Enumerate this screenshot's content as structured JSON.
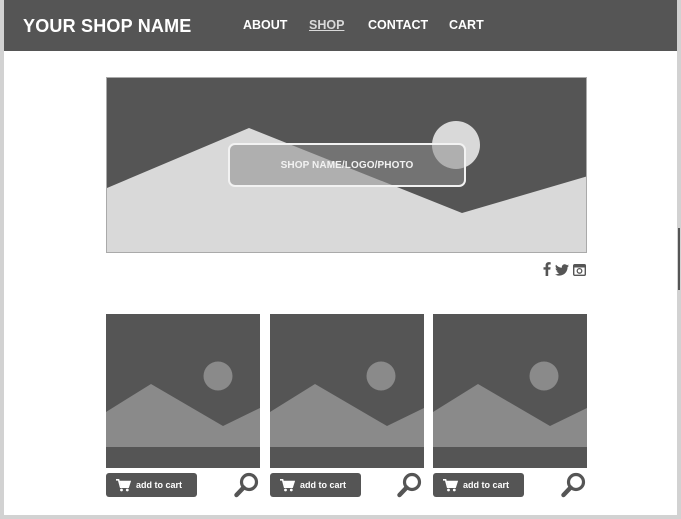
{
  "header": {
    "brand": "YOUR SHOP NAME",
    "nav": [
      {
        "label": "ABOUT",
        "active": false
      },
      {
        "label": "SHOP",
        "active": true
      },
      {
        "label": "CONTACT",
        "active": false
      },
      {
        "label": "CART",
        "active": false
      }
    ]
  },
  "hero": {
    "label": "SHOP NAME/LOGO/PHOTO"
  },
  "social": [
    "facebook-icon",
    "twitter-icon",
    "instagram-icon"
  ],
  "products": [
    {
      "button_label": "add to cart",
      "image": "placeholder-image",
      "zoom_icon": "magnifier-icon"
    },
    {
      "button_label": "add to cart",
      "image": "placeholder-image",
      "zoom_icon": "magnifier-icon"
    },
    {
      "button_label": "add to cart",
      "image": "placeholder-image",
      "zoom_icon": "magnifier-icon"
    }
  ],
  "colors": {
    "dark": "#555555",
    "light": "#d9d9d9",
    "mid": "#8a8a8a",
    "background": "#ffffff"
  }
}
